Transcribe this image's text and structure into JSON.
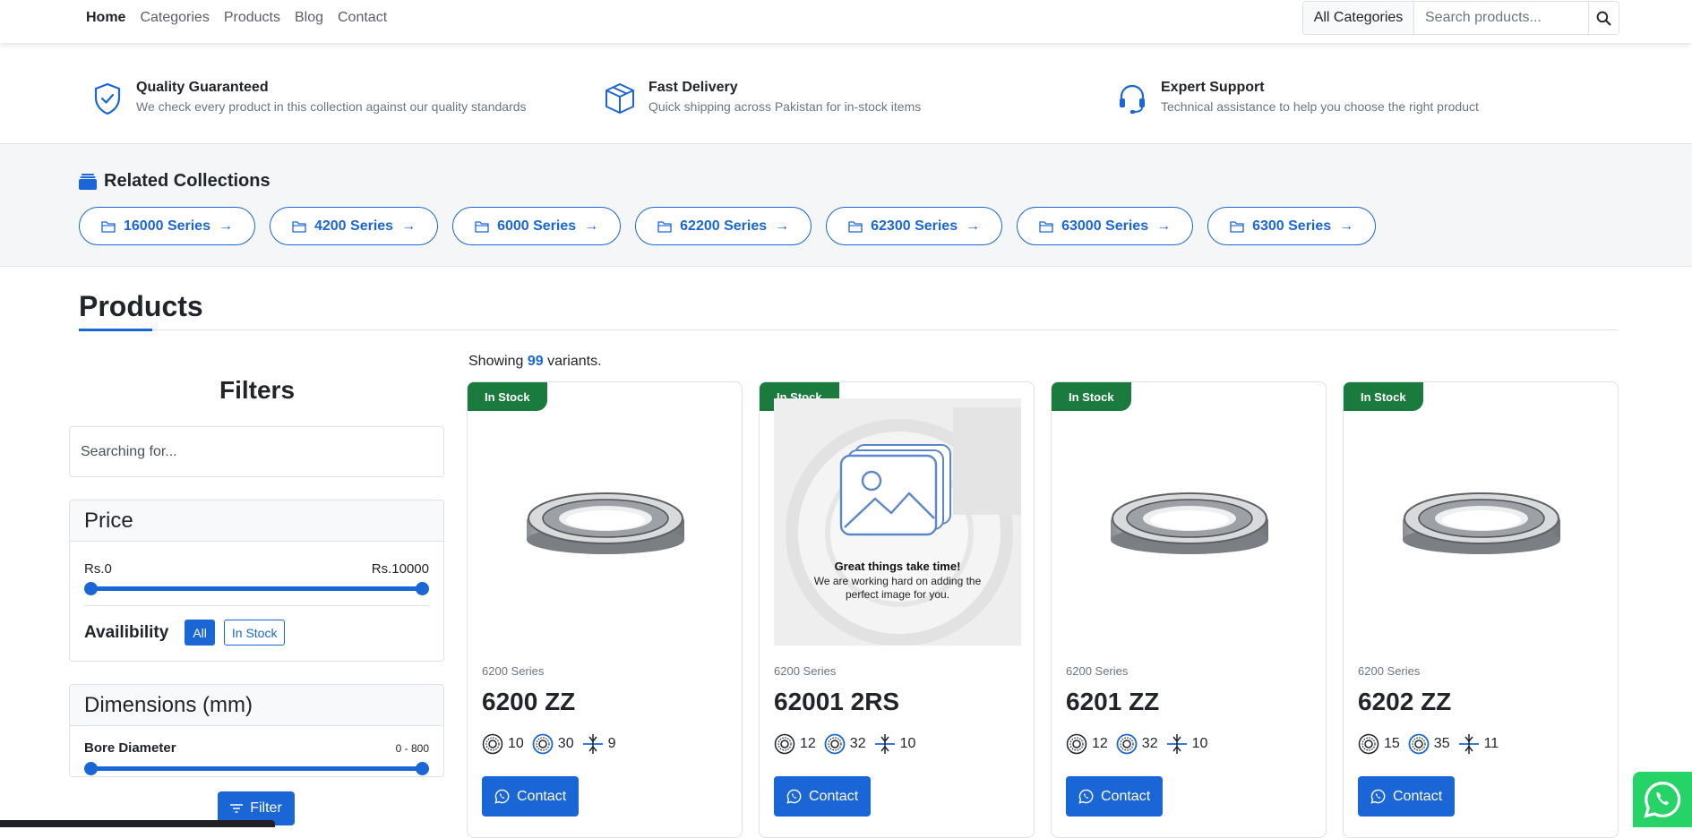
{
  "nav": {
    "links": [
      "Home",
      "Categories",
      "Products",
      "Blog",
      "Contact"
    ],
    "category_select": "All Categories",
    "search_placeholder": "Search products..."
  },
  "features": [
    {
      "icon": "shield-check-icon",
      "title": "Quality Guaranteed",
      "desc": "We check every product in this collection against our quality standards"
    },
    {
      "icon": "box-icon",
      "title": "Fast Delivery",
      "desc": "Quick shipping across Pakistan for in-stock items"
    },
    {
      "icon": "headset-icon",
      "title": "Expert Support",
      "desc": "Technical assistance to help you choose the right product"
    }
  ],
  "related": {
    "title": "Related Collections",
    "collections": [
      "16000 Series",
      "4200 Series",
      "6000 Series",
      "62200 Series",
      "62300 Series",
      "63000 Series",
      "6300 Series"
    ]
  },
  "products_heading": "Products",
  "filters": {
    "title": "Filters",
    "search_placeholder": "Searching for...",
    "price": {
      "heading": "Price",
      "min_label": "Rs.0",
      "max_label": "Rs.10000",
      "min": 0,
      "max": 10000
    },
    "availability": {
      "label": "Availibility",
      "options": [
        "All",
        "In Stock"
      ],
      "selected": "All"
    },
    "dimensions": {
      "heading": "Dimensions (mm)",
      "bore_label": "Bore Diameter",
      "bore_range": "0 - 800"
    },
    "filter_button": "Filter"
  },
  "listing": {
    "showing_prefix": "Showing",
    "count": "99",
    "showing_suffix": "variants."
  },
  "products": [
    {
      "badge": "In Stock",
      "series": "6200 Series",
      "name": "6200 ZZ",
      "bore": "10",
      "outer": "30",
      "width": "9",
      "contact": "Contact",
      "has_image": true
    },
    {
      "badge": "In Stock",
      "series": "6200 Series",
      "name": "62001 2RS",
      "bore": "12",
      "outer": "32",
      "width": "10",
      "contact": "Contact",
      "has_image": false,
      "placeholder_title": "Great things take time!",
      "placeholder_text": "We are working hard on adding the perfect image for you."
    },
    {
      "badge": "In Stock",
      "series": "6200 Series",
      "name": "6201 ZZ",
      "bore": "12",
      "outer": "32",
      "width": "10",
      "contact": "Contact",
      "has_image": true
    },
    {
      "badge": "In Stock",
      "series": "6200 Series",
      "name": "6202 ZZ",
      "bore": "15",
      "outer": "35",
      "width": "11",
      "contact": "Contact",
      "has_image": true
    }
  ],
  "colors": {
    "primary": "#1a66d6",
    "success": "#1b7a3e",
    "whatsapp": "#25d366"
  }
}
